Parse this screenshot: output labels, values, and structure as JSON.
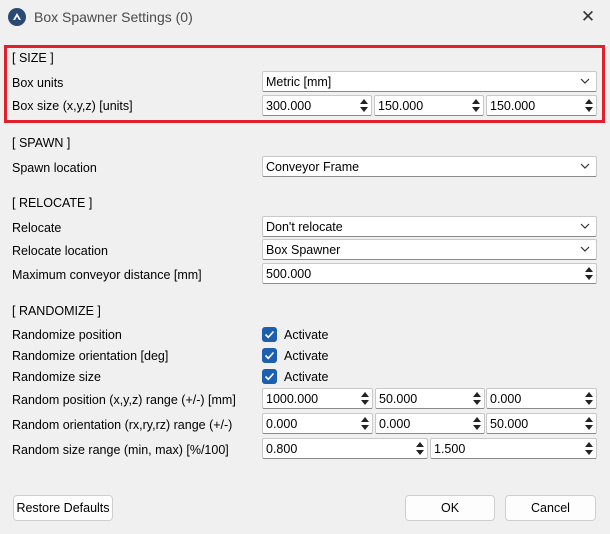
{
  "window": {
    "title": "Box Spawner Settings (0)"
  },
  "size": {
    "heading": "[ SIZE ]",
    "box_units": {
      "label": "Box units",
      "value": "Metric [mm]"
    },
    "box_size": {
      "label": "Box size (x,y,z) [units]",
      "x": "300.000",
      "y": "150.000",
      "z": "150.000"
    }
  },
  "spawn": {
    "heading": "[ SPAWN ]",
    "location": {
      "label": "Spawn location",
      "value": "Conveyor Frame"
    }
  },
  "relocate": {
    "heading": "[ RELOCATE ]",
    "relocate": {
      "label": "Relocate",
      "value": "Don't relocate"
    },
    "location": {
      "label": "Relocate location",
      "value": "Box Spawner"
    },
    "max_distance": {
      "label": "Maximum conveyor distance [mm]",
      "value": "500.000"
    }
  },
  "randomize": {
    "heading": "[ RANDOMIZE ]",
    "position": {
      "label": "Randomize position",
      "checkbox_label": "Activate",
      "checked": true
    },
    "orientation": {
      "label": "Randomize orientation [deg]",
      "checkbox_label": "Activate",
      "checked": true
    },
    "size": {
      "label": "Randomize size",
      "checkbox_label": "Activate",
      "checked": true
    },
    "pos_range": {
      "label": "Random position (x,y,z) range (+/-) [mm]",
      "x": "1000.000",
      "y": "50.000",
      "z": "0.000"
    },
    "orient_range": {
      "label": "Random orientation (rx,ry,rz) range (+/-)",
      "rx": "0.000",
      "ry": "0.000",
      "rz": "50.000"
    },
    "size_range": {
      "label": "Random size range (min, max) [%/100]",
      "min": "0.800",
      "max": "1.500"
    }
  },
  "buttons": {
    "restore": "Restore Defaults",
    "ok": "OK",
    "cancel": "Cancel"
  },
  "colors": {
    "highlight": "#e2202b",
    "checkbox": "#1c5fb0"
  },
  "icons": {
    "app": "robodk-logo-icon",
    "close": "close-icon",
    "dropdown": "chevron-down-icon",
    "spinner": "spinner-arrows-icon",
    "check": "check-icon"
  }
}
